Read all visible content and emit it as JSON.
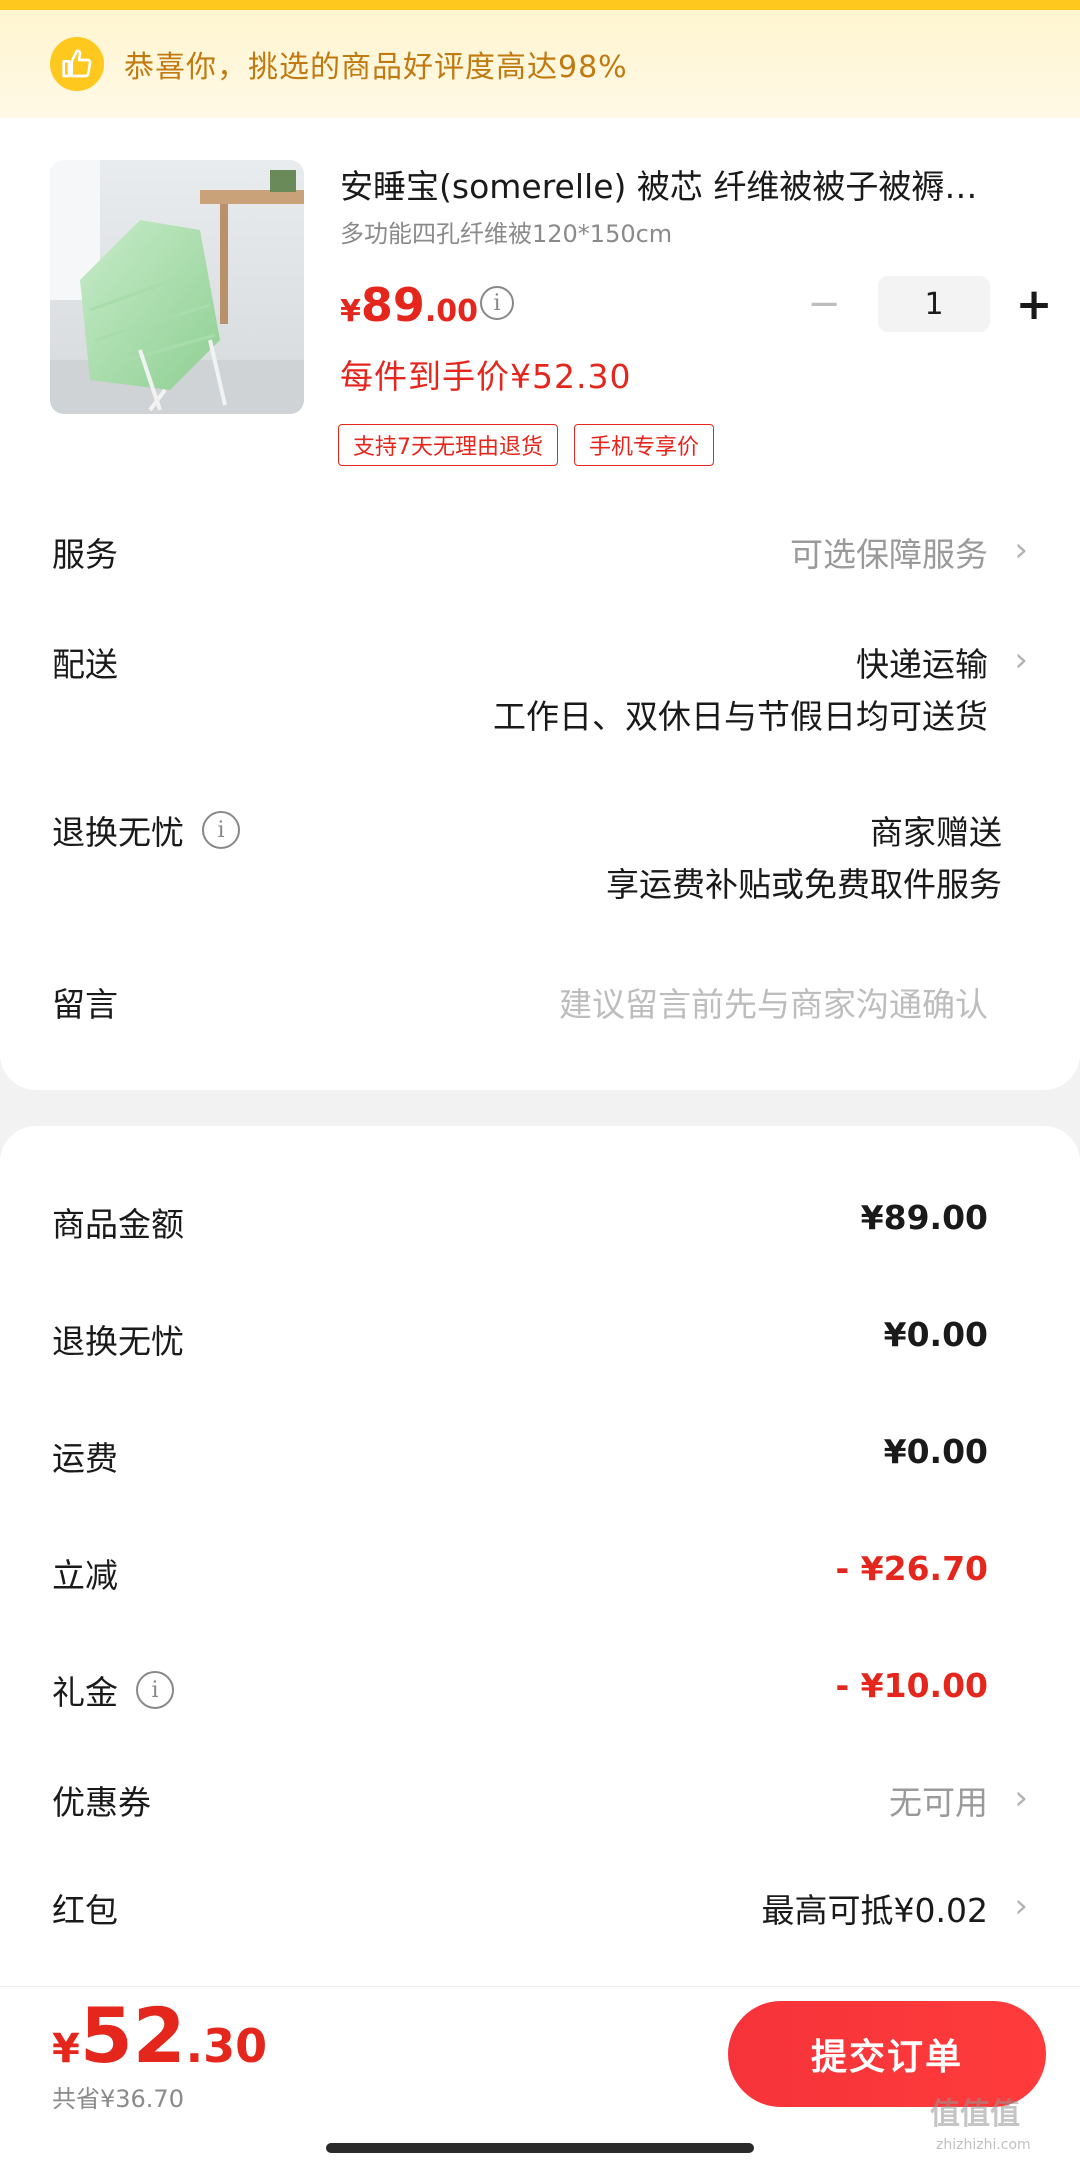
{
  "banner": {
    "text": "恭喜你，挑选的商品好评度高达98%",
    "icon": "thumbs-up-icon"
  },
  "product": {
    "title": "安睡宝(somerelle) 被芯 纤维被被子被褥…",
    "spec": "多功能四孔纤维被120*150cm",
    "price_currency": "¥",
    "price_int": "89",
    "price_dec": ".00",
    "final_price": "每件到手价¥52.30",
    "quantity": "1",
    "minus_label": "−",
    "plus_label": "+",
    "tags": [
      "支持7天无理由退货",
      "手机专享价"
    ]
  },
  "rows": {
    "service": {
      "label": "服务",
      "value": "可选保障服务"
    },
    "delivery": {
      "label": "配送",
      "value": "快递运输",
      "note": "工作日、双休日与节假日均可送货"
    },
    "return": {
      "label": "退换无忧",
      "value": "商家赠送",
      "note": "享运费补贴或免费取件服务"
    },
    "message": {
      "label": "留言",
      "placeholder": "建议留言前先与商家沟通确认"
    }
  },
  "summary": {
    "goods": {
      "label": "商品金额",
      "value": "¥89.00"
    },
    "return_fee": {
      "label": "退换无忧",
      "value": "¥0.00"
    },
    "shipping": {
      "label": "运费",
      "value": "¥0.00"
    },
    "discount": {
      "label": "立减",
      "value": "- ¥26.70"
    },
    "gift": {
      "label": "礼金",
      "value": "- ¥10.00"
    },
    "coupon": {
      "label": "优惠券",
      "value": "无可用"
    },
    "redpacket": {
      "label": "红包",
      "value": "最高可抵¥0.02"
    }
  },
  "footer": {
    "currency": "¥",
    "total_int": "52",
    "total_dec": ".30",
    "saved": "共省¥36.70",
    "submit_label": "提交订单"
  },
  "watermark": {
    "mark": "值值值",
    "site": "zhizhizhi.com"
  },
  "colors": {
    "accent": "#e4261c",
    "banner_text": "#c07a10",
    "banner_bg": "#fff5d0",
    "top_bar": "#ffc81e"
  }
}
